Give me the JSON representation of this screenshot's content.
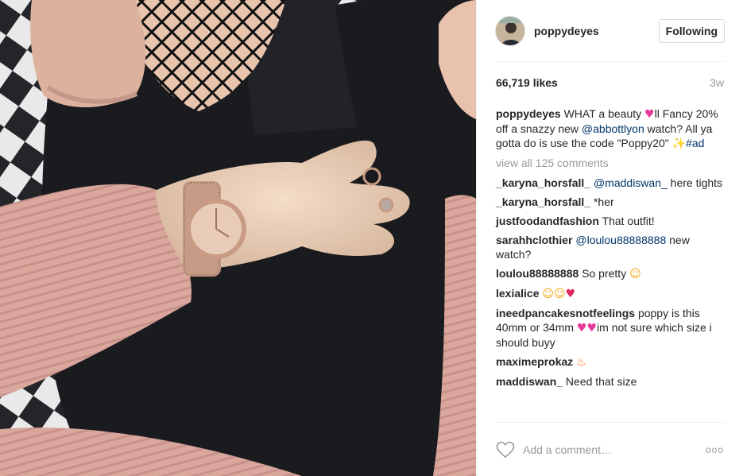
{
  "header": {
    "username": "poppydeyes",
    "follow_label": "Following"
  },
  "post": {
    "likes": "66,719 likes",
    "age": "3w"
  },
  "caption": {
    "username": "poppydeyes",
    "text_1": "WHAT a beauty",
    "text_2": "ll Fancy 20% off a snazzy new",
    "mention": "@abbottlyon",
    "text_3": "watch? All ya gotta do is use the code \"Poppy20\"",
    "hashtag": "#ad"
  },
  "view_all": "view all 125 comments",
  "comments": [
    {
      "user": "_karyna_horsfall_",
      "mention": "@maddiswan_",
      "text": "here tights"
    },
    {
      "user": "_karyna_horsfall_",
      "text": "*her"
    },
    {
      "user": "justfoodandfashion",
      "text": "That outfit!"
    },
    {
      "user": "sarahhclothier",
      "mention": "@loulou88888888",
      "text": "new watch?"
    },
    {
      "user": "loulou88888888",
      "text": "So pretty"
    },
    {
      "user": "lexialice",
      "text": ""
    },
    {
      "user": "ineedpancakesnotfeelings",
      "text_1": "poppy is this 40mm or 34mm",
      "text_2": "im not sure which size i should buyy"
    },
    {
      "user": "maximeprokaz",
      "text": ""
    },
    {
      "user": "maddiswan_",
      "text": "Need that size"
    }
  ],
  "footer": {
    "placeholder": "Add a comment…",
    "more": "ooo"
  },
  "icons": {
    "like": "heart-outline-icon",
    "more": "more-options-icon"
  },
  "colors": {
    "link": "#003569",
    "muted": "#999999",
    "text": "#262626"
  }
}
